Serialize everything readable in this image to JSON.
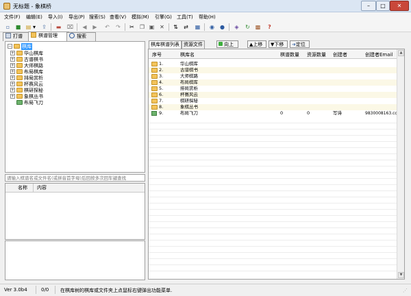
{
  "window": {
    "title": "无标题 - 象棋桥",
    "controls": {
      "minimize": "–",
      "maximize": "□",
      "close": "✕"
    }
  },
  "menu": [
    "文件(F)",
    "编辑(E)",
    "导入(I)",
    "导出(P)",
    "搜索(S)",
    "查看(V)",
    "模拟(M)",
    "引擎(G)",
    "工具(T)",
    "帮助(H)"
  ],
  "toolbar": {
    "icons": [
      "new-doc-icon",
      "save-icon",
      "open-icon",
      "dropdown-icon",
      "export-icon",
      "disk-icon",
      "delete-icon",
      "back-icon",
      "forward-icon",
      "undo-icon",
      "redo-icon",
      "cut-icon",
      "copy-icon",
      "paste-icon",
      "clear-icon",
      "flip-icon",
      "swap-icon",
      "table-icon",
      "engine-icon",
      "play-icon",
      "tag-icon",
      "refresh-icon",
      "library-icon",
      "help-icon"
    ],
    "glyphs": [
      "▫",
      "■",
      "▤",
      "▾",
      "⇪",
      "▬",
      "⌧",
      "◀",
      "▶",
      "↶",
      "↷",
      "✂",
      "❐",
      "▣",
      "✕",
      "⇅",
      "⇄",
      "▦",
      "◉",
      "●",
      "◈",
      "↻",
      "▩",
      "?"
    ]
  },
  "main_tabs": [
    {
      "label": "打谱",
      "active": false
    },
    {
      "label": "棋谱管理",
      "active": true
    },
    {
      "label": "搜索",
      "active": false
    }
  ],
  "tree": {
    "root": "棋库",
    "items": [
      "华山棋库",
      "古谱棋书",
      "大师棋路",
      "布局棋库",
      "排局赏析",
      "杯赛风云",
      "棋研探秘",
      "象棋丛书",
      "布局飞刀"
    ]
  },
  "filter": {
    "placeholder": "请输入棋谱名或文件名(或拼音首字母)后回按多次回车键查找"
  },
  "props": {
    "columns": [
      "名称",
      "内容"
    ]
  },
  "right_tabs": [
    "棋库棋谱列表",
    "资源文件"
  ],
  "right_buttons": [
    "向上",
    "上移",
    "下移",
    "定位"
  ],
  "list": {
    "columns": [
      "序号",
      "棋库名",
      "棋谱数量",
      "资源数量",
      "创建者",
      "创建者Email"
    ],
    "rows": [
      {
        "index": "1.",
        "name": "华山棋库",
        "count": "",
        "res": "",
        "creator": "",
        "email": "",
        "kind": "folder"
      },
      {
        "index": "2.",
        "name": "古谱棋书",
        "count": "",
        "res": "",
        "creator": "",
        "email": "",
        "kind": "folder"
      },
      {
        "index": "3.",
        "name": "大师棋路",
        "count": "",
        "res": "",
        "creator": "",
        "email": "",
        "kind": "folder"
      },
      {
        "index": "4.",
        "name": "布局棋库",
        "count": "",
        "res": "",
        "creator": "",
        "email": "",
        "kind": "folder"
      },
      {
        "index": "5.",
        "name": "排局赏析",
        "count": "",
        "res": "",
        "creator": "",
        "email": "",
        "kind": "folder"
      },
      {
        "index": "6.",
        "name": "杯赛风云",
        "count": "",
        "res": "",
        "creator": "",
        "email": "",
        "kind": "folder"
      },
      {
        "index": "7.",
        "name": "棋研探秘",
        "count": "",
        "res": "",
        "creator": "",
        "email": "",
        "kind": "folder"
      },
      {
        "index": "8.",
        "name": "象棋丛书",
        "count": "",
        "res": "",
        "creator": "",
        "email": "",
        "kind": "folder"
      },
      {
        "index": "9.",
        "name": "布局飞刀",
        "count": "0",
        "res": "0",
        "creator": "写诗",
        "email": "9830008163.com",
        "kind": "book"
      }
    ]
  },
  "status": {
    "version": "Ver 3.0b4",
    "position": "0/0",
    "message": "在棋库树的棋库或文件夹上点鼠标右键弹出功能菜单."
  }
}
